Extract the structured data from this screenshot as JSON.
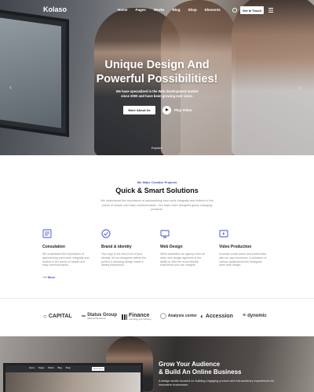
{
  "nav": {
    "logo": "Kolaso",
    "items": [
      "Home",
      "Pages",
      "Works",
      "Blog",
      "Shop",
      "Elements"
    ],
    "cta": "Get In Touch"
  },
  "hero": {
    "title_line1": "Unique Design And",
    "title_line2": "Powerful Possibilities!",
    "subtitle": "We have specialized in the Web development market since 2000 and have been growing ever since.",
    "primary_button": "More About Us",
    "play_label": "Play Video",
    "scroll_hint": "Explore"
  },
  "solutions": {
    "eyebrow": "We Make Creative Projects",
    "title": "Quick & Smart Solutions",
    "description": "We understand the importance of approaching each work integrally and believe in the power of simple and easy communication. Our team have designed game-changing products.",
    "features": [
      {
        "icon": "consultation-icon",
        "title": "Consulation",
        "text": "We understand the importance of approaching each work integrally and believe in the power of simple and easy communication.",
        "more": "More"
      },
      {
        "icon": "brand-identity-icon",
        "title": "Brand & identity",
        "text": "Your logo is the very front of your identity, let our designers deliver the perfect & amazing design made a lasting impression."
      },
      {
        "icon": "web-design-icon",
        "title": "Web Design",
        "text": "What separates our agency from all other web design agencies is the ability to offer the most friendly experience you can imagine."
      },
      {
        "icon": "video-production-icon",
        "title": "Video Production",
        "text": "Increase social reach and productivity with our app resources, a collection of various applications like Instagram other web design."
      }
    ]
  },
  "logos": [
    {
      "name": "CAPITAL",
      "icon": "capital-logo-icon"
    },
    {
      "name": "Status Group",
      "sub": "INNOVATIVE RETAIL",
      "icon": "status-group-logo-icon"
    },
    {
      "name": "Finance",
      "sub": "technology and marketing",
      "icon": "finance-logo-icon"
    },
    {
      "name": "Analysis center",
      "icon": "analysis-center-logo-icon"
    },
    {
      "name": "Accession",
      "icon": "accession-logo-icon"
    },
    {
      "name": "dynomic",
      "icon": "dynomic-logo-icon"
    }
  ],
  "banner": {
    "title_line1": "Grow Your Audience",
    "title_line2": "& Build An Online Business",
    "text": "A design studio focused on building engaging product and extraordinary experiences for innovative businesses.",
    "laptop_nav": [
      "Home",
      "Pages",
      "Works",
      "Blog",
      "Shop"
    ],
    "laptop_cta": "Get In Touch"
  },
  "colors": {
    "accent": "#4153c9",
    "text_dark": "#111111",
    "text_muted": "#8a8a8a"
  }
}
